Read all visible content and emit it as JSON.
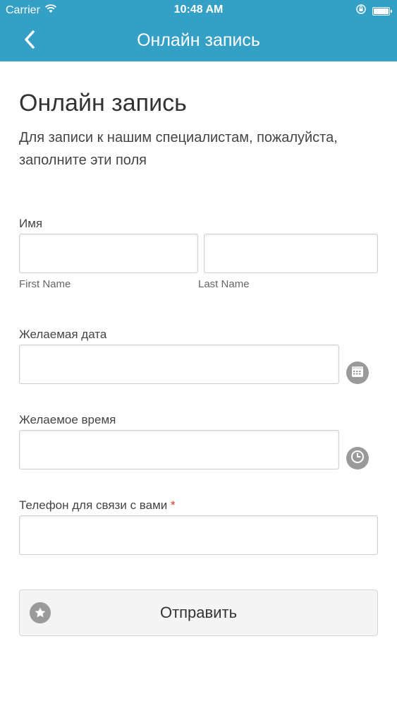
{
  "status_bar": {
    "carrier": "Carrier",
    "time": "10:48 AM",
    "wifi_icon": "wifi-icon",
    "lock_icon": "orientation-lock-icon",
    "battery_icon": "battery-icon"
  },
  "nav": {
    "back_icon": "chevron-left-icon",
    "title": "Онлайн запись",
    "background": "#35a0c6"
  },
  "page": {
    "title": "Онлайн запись",
    "subtitle": "Для записи к нашим специалистам, пожалуйста, заполните эти поля"
  },
  "form": {
    "name": {
      "label": "Имя",
      "first_hint": "First Name",
      "last_hint": "Last Name",
      "first_value": "",
      "last_value": ""
    },
    "date": {
      "label": "Желаемая дата",
      "value": "",
      "icon": "calendar-icon"
    },
    "time": {
      "label": "Желаемое время",
      "value": "",
      "icon": "clock-icon"
    },
    "phone": {
      "label": "Телефон для связи с вами",
      "required_mark": "*",
      "value": ""
    },
    "submit": {
      "label": "Отправить",
      "icon": "star-icon"
    }
  },
  "colors": {
    "accent": "#35a0c6",
    "required": "#d9381e",
    "icon_gray": "#9a9a9a"
  }
}
